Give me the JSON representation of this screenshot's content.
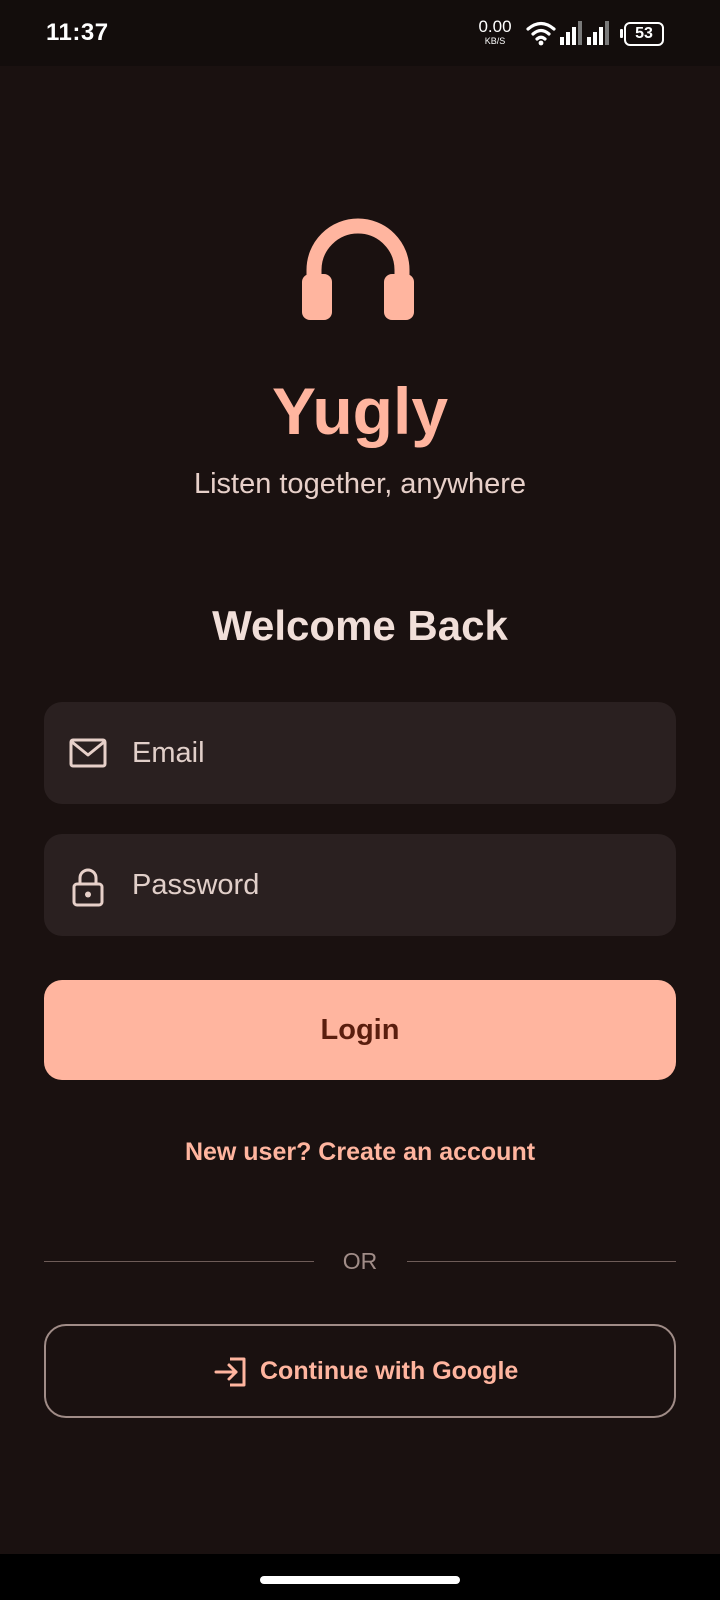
{
  "status_bar": {
    "time": "11:37",
    "net_speed": "0.00",
    "net_unit": "KB/S",
    "battery": "53"
  },
  "app": {
    "name": "Yugly",
    "tagline": "Listen together, anywhere",
    "logo_icon": "headphones-icon"
  },
  "login_form": {
    "heading": "Welcome Back",
    "email_placeholder": "Email",
    "password_placeholder": "Password",
    "login_label": "Login",
    "create_account_label": "New user? Create an account",
    "divider_label": "OR",
    "google_label": "Continue with Google"
  },
  "colors": {
    "background": "#1a1110",
    "accent": "#ffb59f",
    "field_background": "#2a2020",
    "text": "#f1dfd9"
  }
}
